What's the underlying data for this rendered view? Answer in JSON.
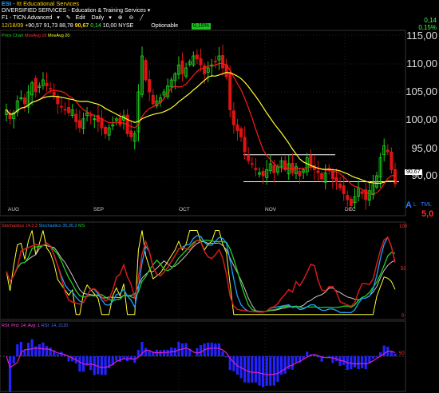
{
  "header": {
    "symbol": "ESI",
    "company": "Itt Educational Services",
    "sector": "DIVERSIFIED SERVICES",
    "industry": "Education & Training Services",
    "layout": "F1 - TICN Advanced",
    "edit_label": "Edit",
    "period": "Daily",
    "date": "12/18/09",
    "open": "+90,57",
    "high": "91,73",
    "low": "88,78",
    "close": "90,67",
    "change": "0,14",
    "volume": "10,00",
    "exchange": "NYSE",
    "optionable_label": "Optionable",
    "optionable_value": "0,15%",
    "right_change": "0,14",
    "right_pct": "0,15%"
  },
  "price_legend": {
    "chart_label": "Price Chart",
    "ma1": "MovAvg 10",
    "ma2": "MovAvg 20"
  },
  "stoch_legend": {
    "s1": "Stochastics 14,3,3",
    "s2": "Stochastics 35,36,3",
    "ms": "MS"
  },
  "rsi_legend": {
    "label": "RSI: Prd: 14; Avg: 1",
    "extra": "RSI: 14, 2120"
  },
  "price_axis": [
    "115,00",
    "110,00",
    "105,00",
    "100,00",
    "95,00",
    "90,00"
  ],
  "stoch_axis": [
    "100",
    "50",
    "0"
  ],
  "rsi_axis": [
    "50"
  ],
  "months": [
    "AUG",
    "SEP",
    "OCT",
    "NOV",
    "DEC"
  ],
  "last_price_tag": "90,67",
  "side_tags": {
    "a": "A",
    "l": "L",
    "tml": "TML",
    "value": "5,0"
  },
  "colors": {
    "up": "#1fd11f",
    "down": "#e01313",
    "ma_fast": "#ff1a1a",
    "ma_slow": "#ffff33",
    "stoch_fast": "#d61a1a",
    "stoch_slow": "#1fa0ff",
    "stoch_ms": "#22d022",
    "stoch_yellow": "#ffff33",
    "stoch_white": "#c8c8c8",
    "rsi_bar": "#2323ff",
    "rsi_line": "#e01ec8"
  },
  "chart_data": {
    "type": "candlestick",
    "closes": [
      103,
      101.5,
      102.5,
      104.5,
      105,
      104,
      106,
      107.5,
      106,
      107,
      108,
      107,
      106.5,
      105.5,
      104,
      103.5,
      103,
      102.5,
      103,
      101,
      100,
      101.5,
      102.5,
      102,
      101.5,
      101,
      100,
      99,
      100,
      100.5,
      101.5,
      100.5,
      102,
      99,
      98.5,
      99,
      106,
      112,
      108,
      106,
      104,
      104.5,
      105,
      106,
      107,
      108,
      109,
      110.5,
      109,
      110,
      111,
      112,
      111.5,
      110.5,
      109,
      110,
      110.5,
      111,
      112,
      110,
      108.5,
      103,
      100.5,
      99.5,
      98.5,
      96,
      94.5,
      94,
      93,
      92.5,
      92,
      93,
      94,
      92.5,
      93.5,
      94.5,
      93,
      94,
      92.5,
      93.5,
      92,
      93,
      95,
      93.5,
      93,
      92.5,
      91.5,
      92.5,
      93,
      91.5,
      91,
      90,
      89,
      88,
      87,
      88.5,
      90,
      89,
      88,
      89.5,
      90.5,
      92,
      95,
      97,
      96,
      93,
      90.67
    ],
    "price_range": [
      86,
      116
    ],
    "stoch_range": [
      0,
      100
    ]
  }
}
